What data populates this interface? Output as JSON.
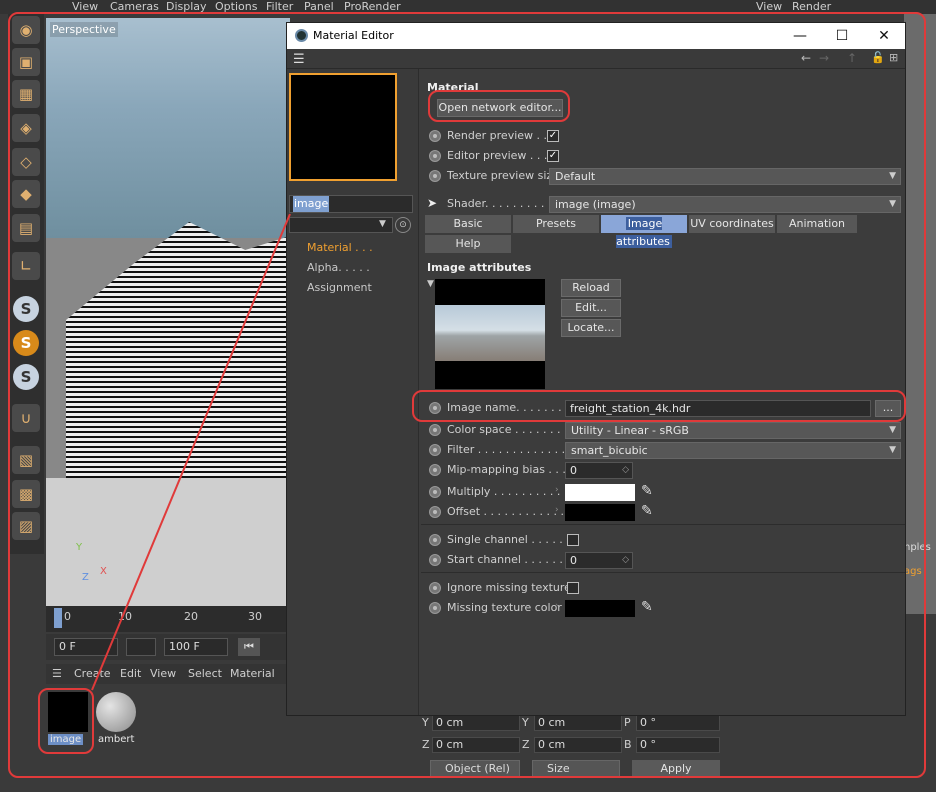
{
  "top_menu": [
    "View",
    "Cameras",
    "Display",
    "Options",
    "Filter",
    "Panel",
    "ProRender"
  ],
  "top_menu_right": [
    "View",
    "Render"
  ],
  "viewport": {
    "label": "Perspective",
    "axis_y": "Y",
    "axis_x": "X",
    "axis_z": "Z"
  },
  "timeline": {
    "ticks": [
      "0",
      "10",
      "20",
      "30"
    ],
    "current_frame": "0 F",
    "end_frame": "100 F"
  },
  "material_manager": {
    "menu": [
      "Create",
      "Edit",
      "View",
      "Select",
      "Material"
    ],
    "materials": [
      {
        "name": "image",
        "color": "#000000"
      },
      {
        "name": "ambert",
        "color": "#bdbdbd"
      }
    ]
  },
  "editor": {
    "title": "Material Editor",
    "win_buttons": {
      "minimize": "—",
      "maximize": "☐",
      "close": "✕"
    },
    "material_name": "image",
    "channels": [
      {
        "label": "Material . . . ",
        "active": true
      },
      {
        "label": "Alpha. . . . . ",
        "active": false
      },
      {
        "label": "Assignment",
        "active": false
      }
    ],
    "section_material": "Material",
    "open_network_editor": "Open network editor...",
    "render_preview": "Render preview . . .",
    "editor_preview": "Editor preview . . . .",
    "texture_preview_size": "Texture preview size",
    "texture_preview_value": "Default",
    "shader_label": "Shader. . . . . . . . . .",
    "shader_value": "image (image)",
    "tabs": [
      "Basic",
      "Presets",
      "Image attributes",
      "UV coordinates",
      "Animation",
      "Help"
    ],
    "active_tab": "Image attributes",
    "section_image": "Image attributes",
    "reload": "Reload",
    "edit": "Edit...",
    "locate": "Locate...",
    "image_name_label": "Image name. . . . . . . .",
    "image_name_value": "freight_station_4k.hdr",
    "browse": "...",
    "color_space_label": "Color space . . . . . . . . . .",
    "color_space_value": "Utility - Linear - sRGB",
    "filter_label": "Filter . . . . . . . . . . . . . .",
    "filter_value": "smart_bicubic",
    "mip_label": "Mip-mapping bias . . .",
    "mip_value": "0",
    "multiply_label": "Multiply . . . . . . . . . .",
    "multiply_color": "#ffffff",
    "offset_label": "Offset . . . . . . . . . . . .",
    "offset_color": "#000000",
    "single_channel_label": "Single channel . . . . . .",
    "start_channel_label": "Start channel . . . . . . .",
    "start_channel_value": "0",
    "ignore_missing_label": "Ignore missing textures",
    "missing_color_label": "Missing texture color",
    "missing_color": "#000000"
  },
  "coords": {
    "rows": [
      {
        "a": "Y",
        "av": "0 cm",
        "b": "Y",
        "bv": "0 cm",
        "c": "P",
        "cv": "0 °"
      },
      {
        "a": "Z",
        "av": "0 cm",
        "b": "Z",
        "bv": "0 cm",
        "c": "B",
        "cv": "0 °"
      }
    ],
    "mode": "Object (Rel)",
    "size": "Size",
    "apply": "Apply"
  },
  "right_strip": {
    "labels": [
      "nples",
      "ags"
    ]
  },
  "accent": "#f0a030",
  "highlight": "#e03a3a"
}
